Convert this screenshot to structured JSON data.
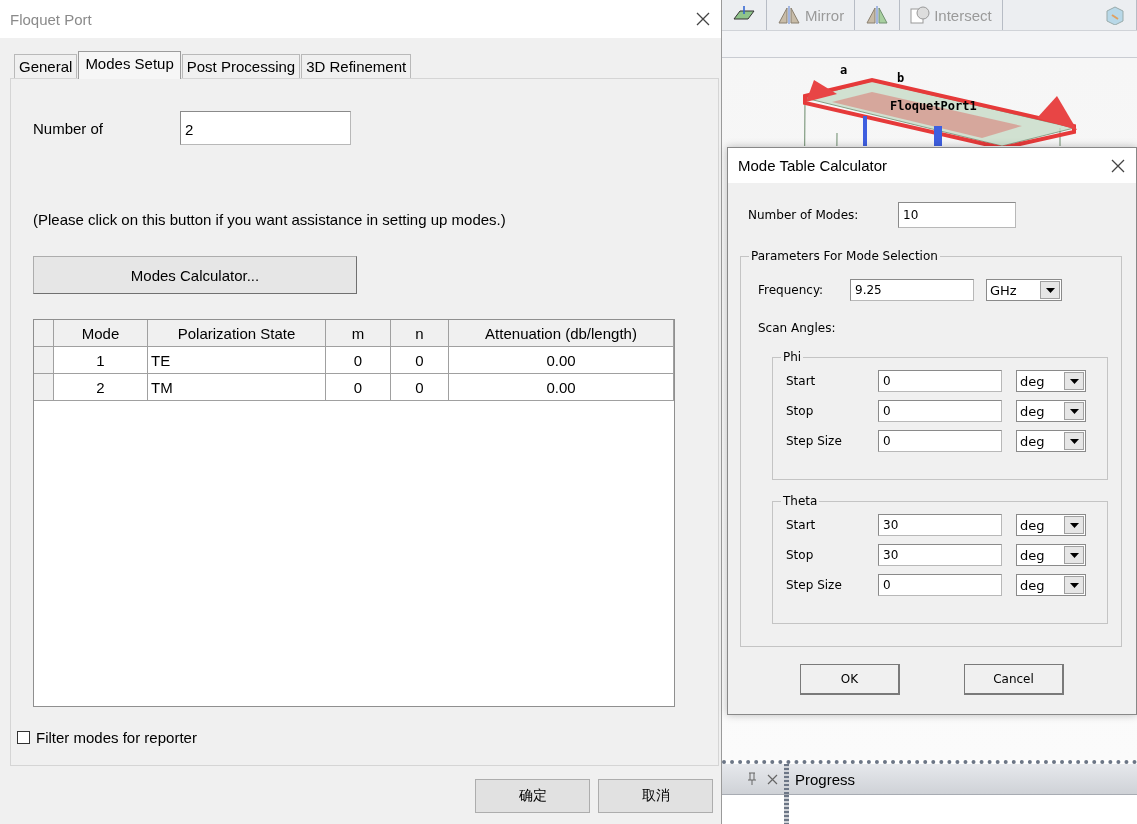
{
  "background_app": {
    "toolbar": {
      "buttons": [
        {
          "kind": "plane"
        },
        {
          "kind": "mirror",
          "label": "Mirror"
        },
        {
          "kind": "mirror2"
        },
        {
          "kind": "intersect",
          "label": "Intersect"
        },
        {
          "kind": "cube"
        }
      ]
    },
    "viewport": {
      "labels": [
        "a",
        "b",
        "FloquetPort1"
      ]
    },
    "bottom_panel": {
      "title": "Progress"
    }
  },
  "floquet_dialog": {
    "title": "Floquet Port",
    "tabs": [
      {
        "label": "General",
        "selected": false
      },
      {
        "label": "Modes Setup",
        "selected": true
      },
      {
        "label": "Post Processing",
        "selected": false
      },
      {
        "label": "3D Refinement",
        "selected": false
      }
    ],
    "number_label": "Number of",
    "number_value": "2",
    "hint": "(Please click on this button if you want assistance in setting up modes.)",
    "calculator_button": "Modes Calculator...",
    "table": {
      "columns": [
        "Mode",
        "Polarization State",
        "m",
        "n",
        "Attenuation (db/length)"
      ],
      "rows": [
        [
          "1",
          "TE",
          "0",
          "0",
          "0.00"
        ],
        [
          "2",
          "TM",
          "0",
          "0",
          "0.00"
        ]
      ]
    },
    "filter": {
      "label": "Filter modes for reporter",
      "checked": false
    },
    "buttons": [
      "确定",
      "取消"
    ]
  },
  "mode_table_calculator": {
    "title": "Mode Table Calculator",
    "modes_label": "Number of Modes:",
    "modes_value": "10",
    "group_title": "Parameters For Mode Selection",
    "frequency": {
      "label": "Frequency:",
      "value": "9.25",
      "unit": "GHz"
    },
    "scan_label": "Scan Angles:",
    "groups": [
      {
        "title": "Phi",
        "rows": [
          {
            "label": "Start",
            "value": "0",
            "unit": "deg"
          },
          {
            "label": "Stop",
            "value": "0",
            "unit": "deg"
          },
          {
            "label": "Step Size",
            "value": "0",
            "unit": "deg"
          }
        ]
      },
      {
        "title": "Theta",
        "rows": [
          {
            "label": "Start",
            "value": "30",
            "unit": "deg"
          },
          {
            "label": "Stop",
            "value": "30",
            "unit": "deg"
          },
          {
            "label": "Step Size",
            "value": "0",
            "unit": "deg"
          }
        ]
      }
    ],
    "buttons": [
      "OK",
      "Cancel"
    ]
  }
}
